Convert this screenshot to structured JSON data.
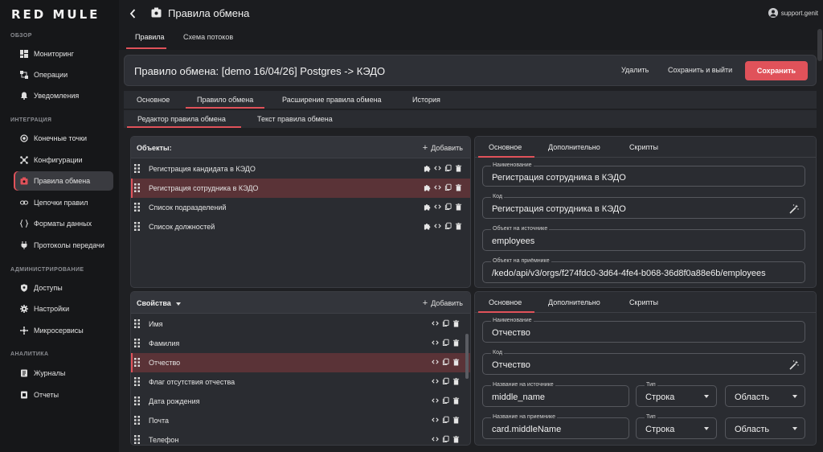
{
  "app": {
    "logo": "RED MULE"
  },
  "sidebar": {
    "sections": [
      {
        "title": "ОБЗОР",
        "items": [
          {
            "label": "Мониторинг",
            "icon": "dashboard-icon"
          },
          {
            "label": "Операции",
            "icon": "operations-icon"
          },
          {
            "label": "Уведомления",
            "icon": "bell-icon"
          }
        ]
      },
      {
        "title": "ИНТЕГРАЦИЯ",
        "items": [
          {
            "label": "Конечные точки",
            "icon": "endpoint-icon"
          },
          {
            "label": "Конфигурации",
            "icon": "config-icon"
          },
          {
            "label": "Правила обмена",
            "icon": "rules-icon",
            "active": true
          },
          {
            "label": "Цепочки правил",
            "icon": "chain-icon"
          },
          {
            "label": "Форматы данных",
            "icon": "braces-icon"
          },
          {
            "label": "Протоколы передачи",
            "icon": "plug-icon"
          }
        ]
      },
      {
        "title": "АДМИНИСТРИРОВАНИЕ",
        "items": [
          {
            "label": "Доступы",
            "icon": "shield-icon"
          },
          {
            "label": "Настройки",
            "icon": "gear-icon"
          },
          {
            "label": "Микросервисы",
            "icon": "microservices-icon"
          }
        ]
      },
      {
        "title": "АНАЛИТИКА",
        "items": [
          {
            "label": "Журналы",
            "icon": "journal-icon"
          },
          {
            "label": "Отчеты",
            "icon": "report-icon"
          }
        ]
      }
    ]
  },
  "topbar": {
    "title": "Правила обмена",
    "user": "support.genit"
  },
  "page_tabs": {
    "items": [
      "Правила",
      "Схема потоков"
    ],
    "active": 0
  },
  "header": {
    "title": "Правило обмена: [demo 16/04/26] Postgres -> КЭДО",
    "delete_label": "Удалить",
    "save_exit_label": "Сохранить и выйти",
    "save_label": "Сохранить"
  },
  "rule_tabs": {
    "items": [
      "Основное",
      "Правило обмена",
      "Расширение правила обмена",
      "История"
    ],
    "active": 1
  },
  "editor_tabs": {
    "items": [
      "Редактор правила обмена",
      "Текст правила обмена"
    ],
    "active": 0
  },
  "objects": {
    "title": "Объекты:",
    "add_label": "Добавить",
    "items": [
      "Регистрация кандидата в КЭДО",
      "Регистрация сотрудника в КЭДО",
      "Список подразделений",
      "Список должностей"
    ],
    "selected": 1
  },
  "object_detail": {
    "tabs": [
      "Основное",
      "Дополнительно",
      "Скрипты"
    ],
    "name_label": "Наименование",
    "name_value": "Регистрация сотрудника в КЭДО",
    "code_label": "Код",
    "code_value": "Регистрация сотрудника в КЭДО",
    "source_label": "Объект на источнике",
    "source_value": "employees",
    "target_label": "Объект на приёмнике",
    "target_value": "/kedo/api/v3/orgs/f274fdc0-3d64-4fe4-b068-36d8f0a88e6b/employees"
  },
  "properties": {
    "title": "Свойства",
    "add_label": "Добавить",
    "items": [
      "Имя",
      "Фамилия",
      "Отчество",
      "Флаг отсутствия отчества",
      "Дата рождения",
      "Почта",
      "Телефон"
    ],
    "selected": 2
  },
  "property_detail": {
    "tabs": [
      "Основное",
      "Дополнительно",
      "Скрипты"
    ],
    "name_label": "Наименование",
    "name_value": "Отчество",
    "code_label": "Код",
    "code_value": "Отчество",
    "source_name_label": "Название на источнике",
    "source_name_value": "middle_name",
    "type_label": "Тип",
    "source_type_value": "Строка",
    "area_placeholder": "Область",
    "target_name_label": "Название на приемнике",
    "target_name_value": "card.middleName",
    "target_type_value": "Строка"
  },
  "colors": {
    "accent": "#e0525a",
    "sidebar_bg": "#161719",
    "panel_bg": "#2a2c31",
    "selected_row": "#5a3337"
  }
}
